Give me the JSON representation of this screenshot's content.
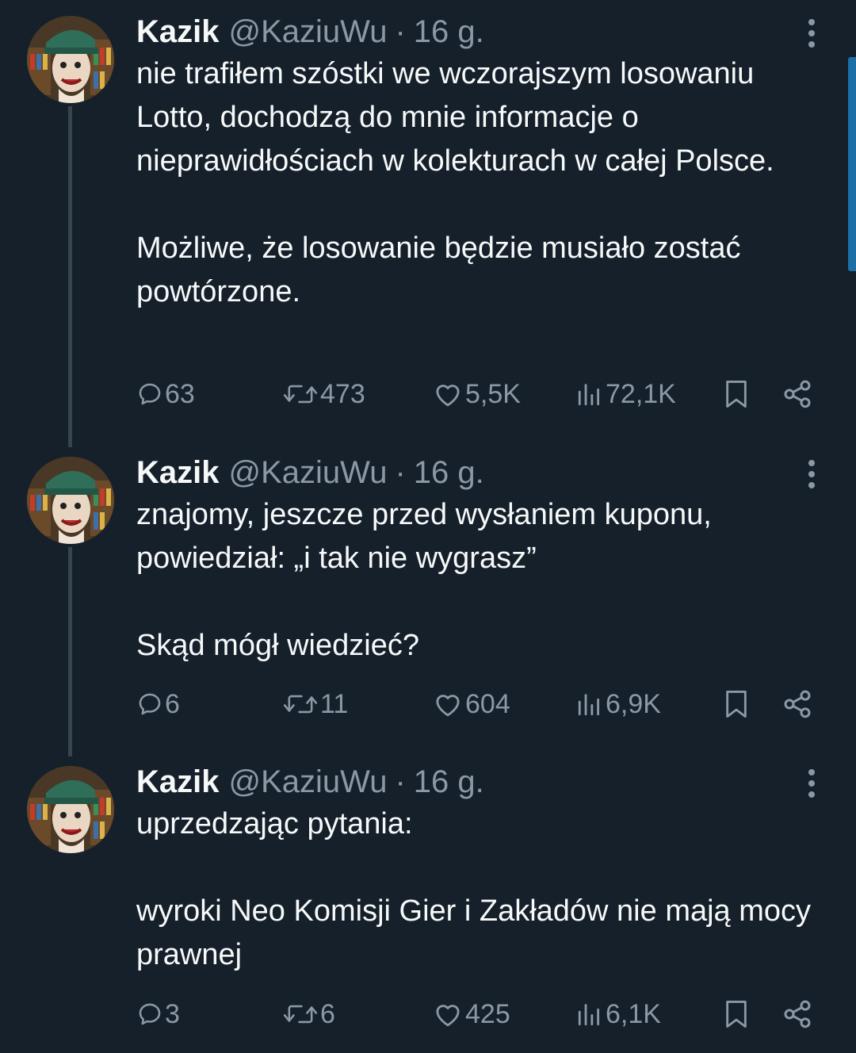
{
  "tweets": [
    {
      "name": "Kazik",
      "handle": "@KaziuWu",
      "separator": "·",
      "time": "16 g.",
      "paragraphs": [
        "nie trafiłem szóstki we wczorajszym losowaniu Lotto, dochodzą do mnie informacje o nieprawidłościach w kolekturach w całej Polsce.",
        "Możliwe, że losowanie będzie musiało zostać powtórzone."
      ],
      "replies": "63",
      "reposts": "473",
      "likes": "5,5K",
      "views": "72,1K"
    },
    {
      "name": "Kazik",
      "handle": "@KaziuWu",
      "separator": "·",
      "time": "16 g.",
      "paragraphs": [
        "znajomy, jeszcze przed wysłaniem kuponu, powiedział: „i tak nie wygrasz”",
        "Skąd mógł wiedzieć?"
      ],
      "replies": "6",
      "reposts": "11",
      "likes": "604",
      "views": "6,9K"
    },
    {
      "name": "Kazik",
      "handle": "@KaziuWu",
      "separator": "·",
      "time": "16 g.",
      "paragraphs": [
        "uprzedzając pytania:",
        "wyroki Neo Komisji Gier i Zakładów nie mają mocy prawnej"
      ],
      "replies": "3",
      "reposts": "6",
      "likes": "425",
      "views": "6,1K"
    }
  ],
  "icons": {
    "reply": "speech-bubble-icon",
    "repost": "repost-arrows-icon",
    "like": "heart-icon",
    "views": "bar-chart-icon",
    "bookmark": "bookmark-icon",
    "share": "share-icon",
    "more": "vertical-dots-icon"
  },
  "colors": {
    "background": "#15202b",
    "text": "#f7f9f9",
    "secondary": "#8b98a5",
    "thread_line": "#38444d",
    "scroll_accent": "#1d6fa8"
  }
}
